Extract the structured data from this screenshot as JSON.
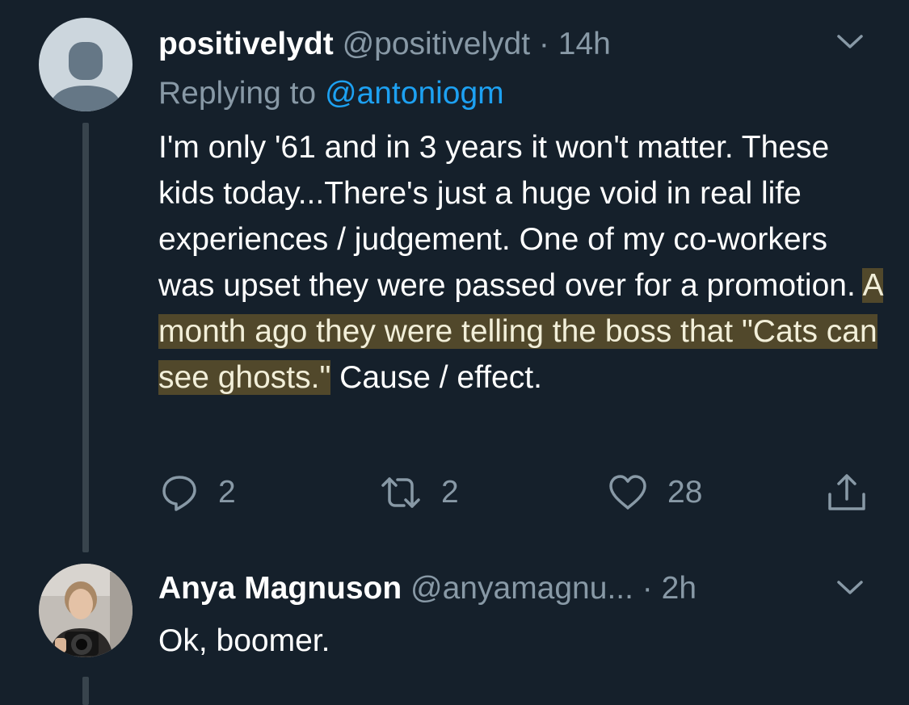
{
  "tweets": [
    {
      "display_name": "positivelydt",
      "handle": "@positivelydt",
      "separator": "·",
      "time": "14h",
      "replying_to_prefix": "Replying to ",
      "replying_to_handle": "@antoniogm",
      "text_before": "I'm only '61 and in 3 years it won't matter. These kids today...There's just a huge void in real life experiences / judgement. One of my co-workers was upset they were passed over for a promotion. ",
      "text_highlighted": "A month ago they were telling the boss that \"Cats can see ghosts.\"",
      "text_after": " Cause / effect.",
      "reply_count": "2",
      "retweet_count": "2",
      "like_count": "28",
      "icons": {
        "avatar": "default-avatar-icon",
        "menu": "chevron-down-icon",
        "reply": "reply-icon",
        "retweet": "retweet-icon",
        "like": "heart-icon",
        "share": "share-icon"
      }
    },
    {
      "display_name": "Anya Magnuson",
      "handle": "@anyamagnu...",
      "separator": "·",
      "time": "2h",
      "text": "Ok, boomer.",
      "icons": {
        "avatar": "user-photo-avatar",
        "menu": "chevron-down-icon"
      }
    }
  ],
  "colors": {
    "background": "#15202b",
    "text": "#ffffff",
    "muted": "#8899a6",
    "link": "#1da1f2",
    "thread_line": "#38444d",
    "highlight": "#51482b"
  }
}
